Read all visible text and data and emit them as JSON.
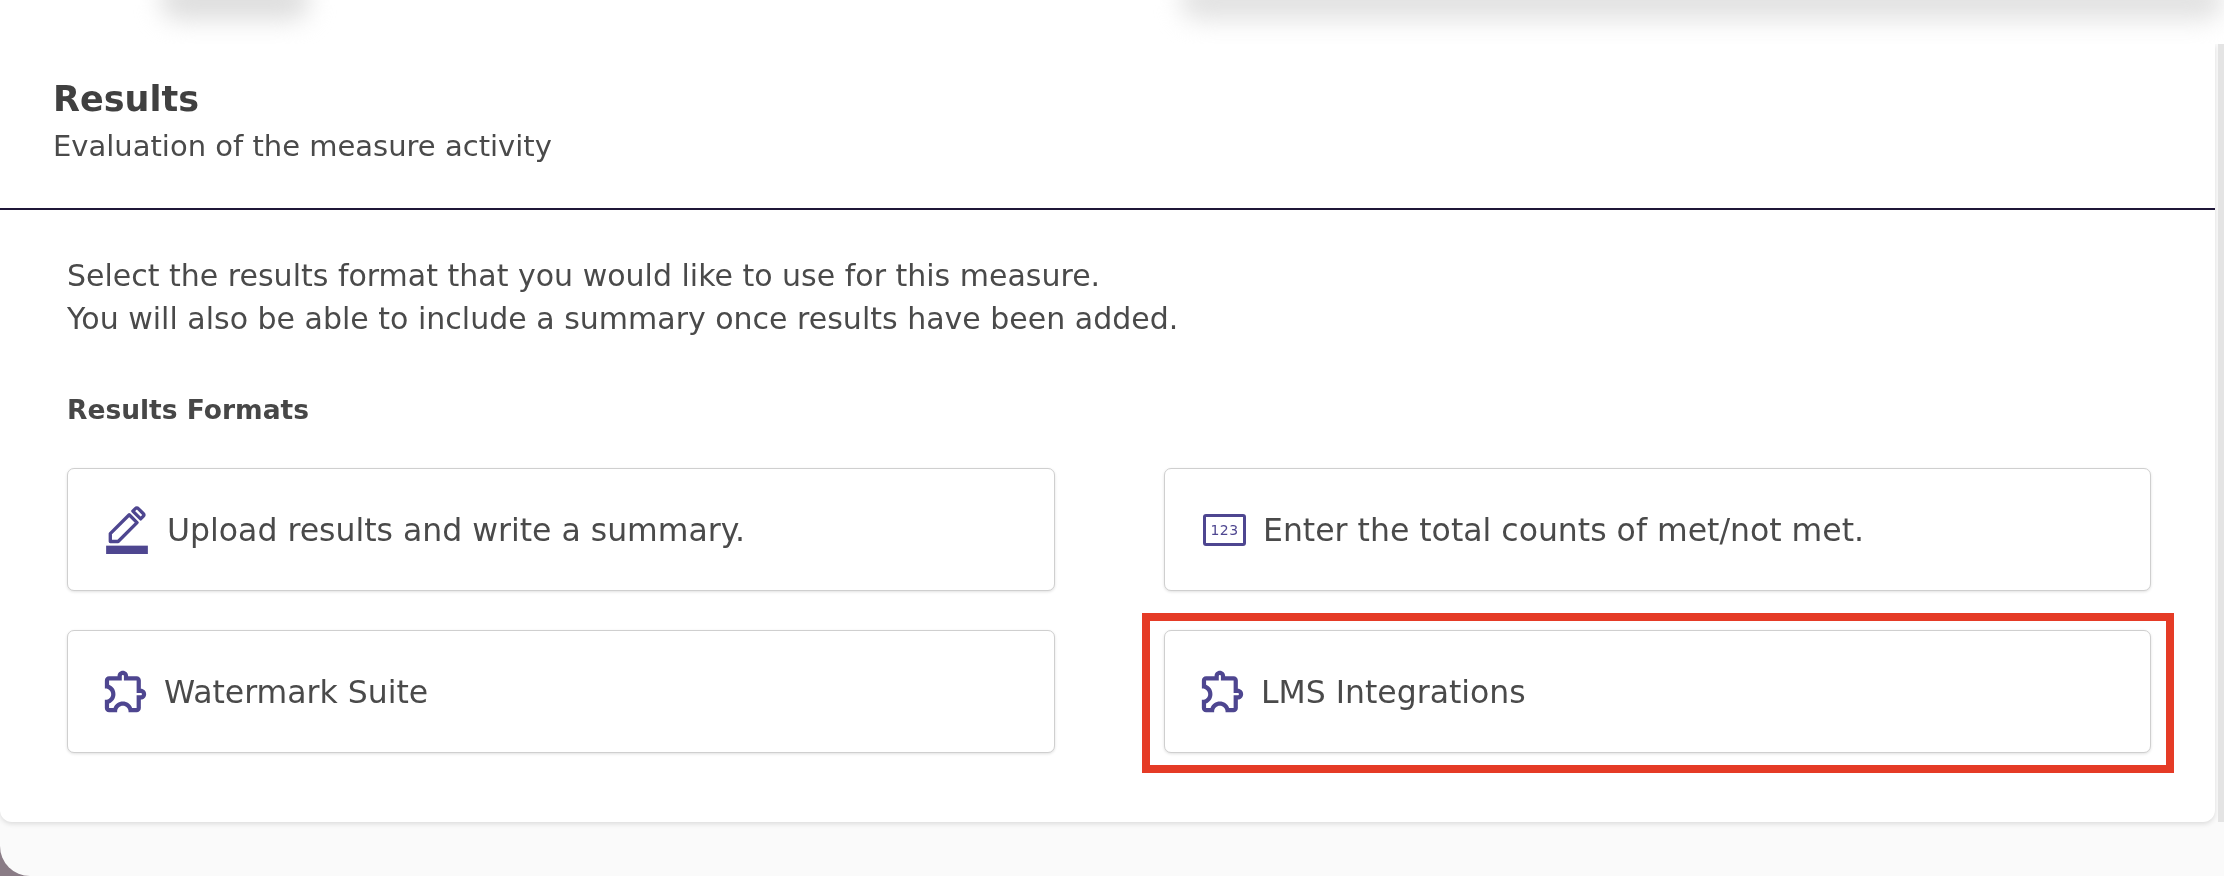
{
  "panel": {
    "title": "Results",
    "subtitle": "Evaluation of the measure activity"
  },
  "instructions": [
    "Select the results format that you would like to use for this measure.",
    "You will also be able to include a summary once results have been added."
  ],
  "formats": {
    "heading": "Results Formats",
    "options": [
      {
        "kind": "upload",
        "label": "Upload results and write a summary.",
        "highlighted": false
      },
      {
        "kind": "counts",
        "icon_text": "123",
        "label": "Enter the total counts of met/not met.",
        "highlighted": false
      },
      {
        "kind": "integration",
        "label": "Watermark Suite",
        "highlighted": false
      },
      {
        "kind": "integration",
        "label": "LMS Integrations",
        "highlighted": true
      }
    ]
  }
}
